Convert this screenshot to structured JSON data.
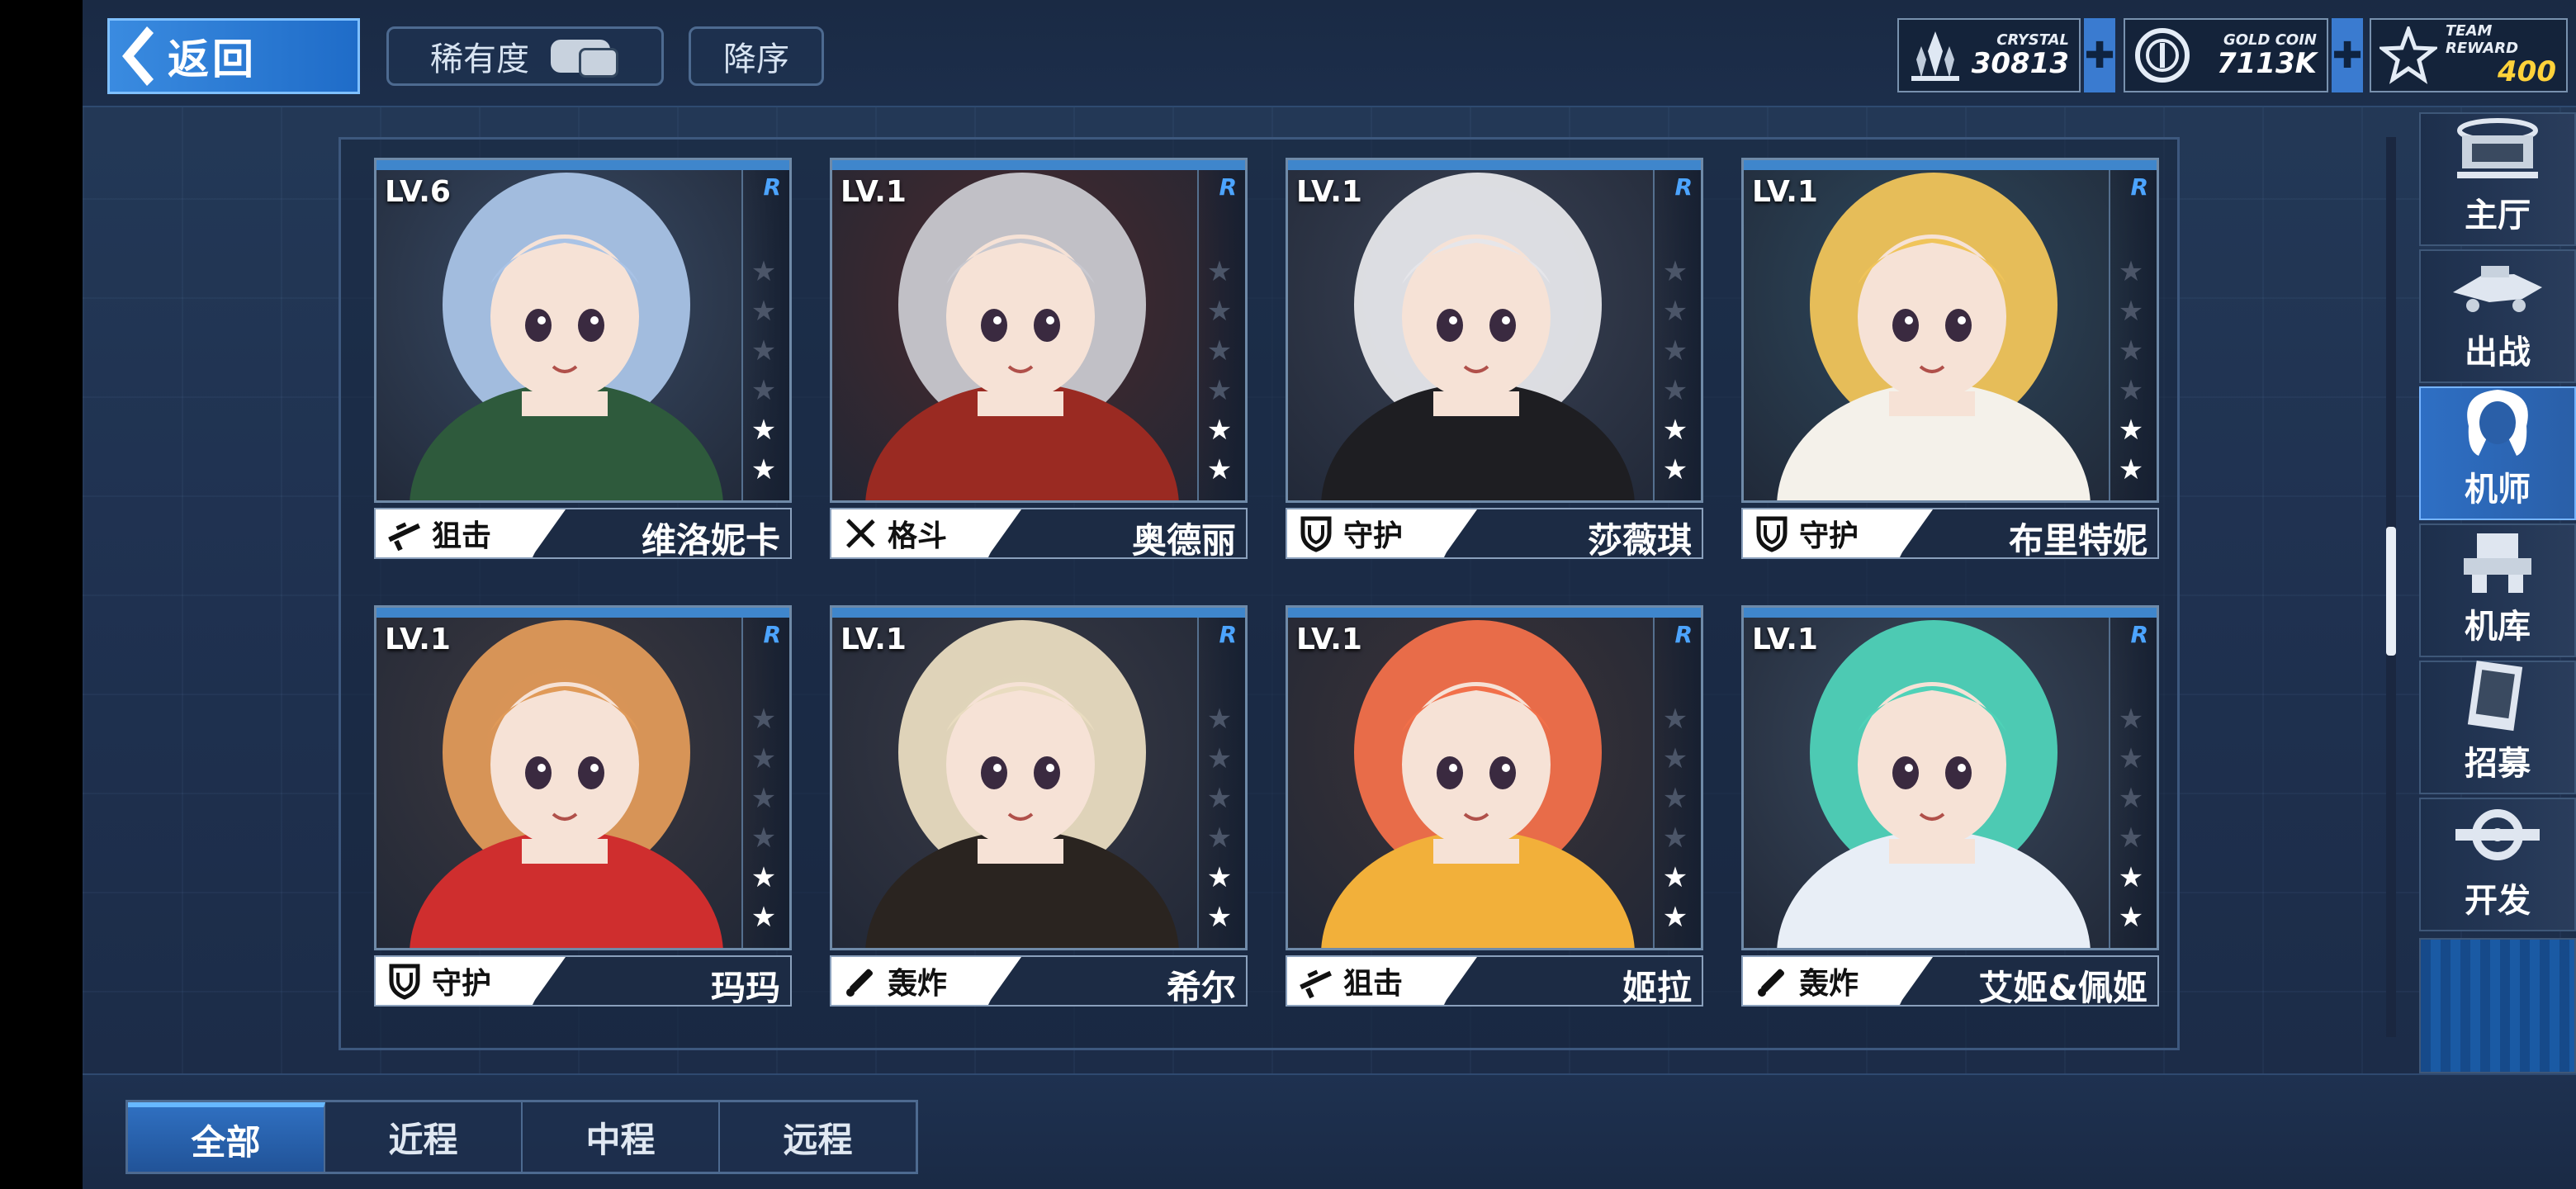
{
  "header": {
    "back_label": "返回",
    "sort_rarity_label": "稀有度",
    "sort_order_label": "降序"
  },
  "currencies": [
    {
      "caption": "CRYSTAL",
      "value": "30813",
      "icon": "crystal-icon"
    },
    {
      "caption": "GOLD COIN",
      "value": "7113K",
      "icon": "gold-coin-icon"
    },
    {
      "caption": "TEAM REWARD",
      "value": "400",
      "icon": "team-reward-icon",
      "value_color": "#ffd23a"
    }
  ],
  "pilots": [
    {
      "level": "LV.6",
      "rarity": "R",
      "class": "狙击",
      "class_icon": "sniper-rifle-icon",
      "name": "维洛妮卡",
      "stars": 2,
      "max_stars": 6,
      "hair": "#a9c3e6",
      "bg": "#3a4c66",
      "outfit": "#2e5a3c"
    },
    {
      "level": "LV.1",
      "rarity": "R",
      "class": "格斗",
      "class_icon": "crossed-swords-icon",
      "name": "奥德丽",
      "stars": 2,
      "max_stars": 6,
      "hair": "#c8c8cf",
      "bg": "#4a2a2c",
      "outfit": "#9a2a22"
    },
    {
      "level": "LV.1",
      "rarity": "R",
      "class": "守护",
      "class_icon": "shield-icon",
      "name": "莎薇琪",
      "stars": 2,
      "max_stars": 6,
      "hair": "#e6e6ea",
      "bg": "#3b4355",
      "outfit": "#1e1e22"
    },
    {
      "level": "LV.1",
      "rarity": "R",
      "class": "守护",
      "class_icon": "shield-icon",
      "name": "布里特妮",
      "stars": 2,
      "max_stars": 6,
      "hair": "#f0c45a",
      "bg": "#2f4a5e",
      "outfit": "#f4f1ea"
    },
    {
      "level": "LV.1",
      "rarity": "R",
      "class": "守护",
      "class_icon": "shield-icon",
      "name": "玛玛",
      "stars": 2,
      "max_stars": 6,
      "hair": "#e09a58",
      "bg": "#3e3a40",
      "outfit": "#cf2e2e"
    },
    {
      "level": "LV.1",
      "rarity": "R",
      "class": "轰炸",
      "class_icon": "bomb-launcher-icon",
      "name": "希尔",
      "stars": 2,
      "max_stars": 6,
      "hair": "#e9dcc0",
      "bg": "#3a3b46",
      "outfit": "#2a2420"
    },
    {
      "level": "LV.1",
      "rarity": "R",
      "class": "狙击",
      "class_icon": "sniper-rifle-icon",
      "name": "姬拉",
      "stars": 2,
      "max_stars": 6,
      "hair": "#f2704a",
      "bg": "#3d3438",
      "outfit": "#f2b03a"
    },
    {
      "level": "LV.1",
      "rarity": "R",
      "class": "轰炸",
      "class_icon": "bomb-launcher-icon",
      "name": "艾姬&佩姬",
      "stars": 2,
      "max_stars": 6,
      "hair": "#4fd2b8",
      "bg": "#3b4a5e",
      "outfit": "#e8eef6"
    }
  ],
  "nav": [
    {
      "label": "主厅",
      "icon": "main-hall-icon",
      "active": false
    },
    {
      "label": "出战",
      "icon": "sortie-icon",
      "active": false
    },
    {
      "label": "机师",
      "icon": "pilot-icon",
      "active": true
    },
    {
      "label": "机库",
      "icon": "hangar-icon",
      "active": false
    },
    {
      "label": "招募",
      "icon": "recruit-card-icon",
      "active": false
    },
    {
      "label": "开发",
      "icon": "develop-gear-icon",
      "active": false
    }
  ],
  "tabs": [
    {
      "label": "全部",
      "active": true
    },
    {
      "label": "近程",
      "active": false
    },
    {
      "label": "中程",
      "active": false
    },
    {
      "label": "远程",
      "active": false
    }
  ]
}
